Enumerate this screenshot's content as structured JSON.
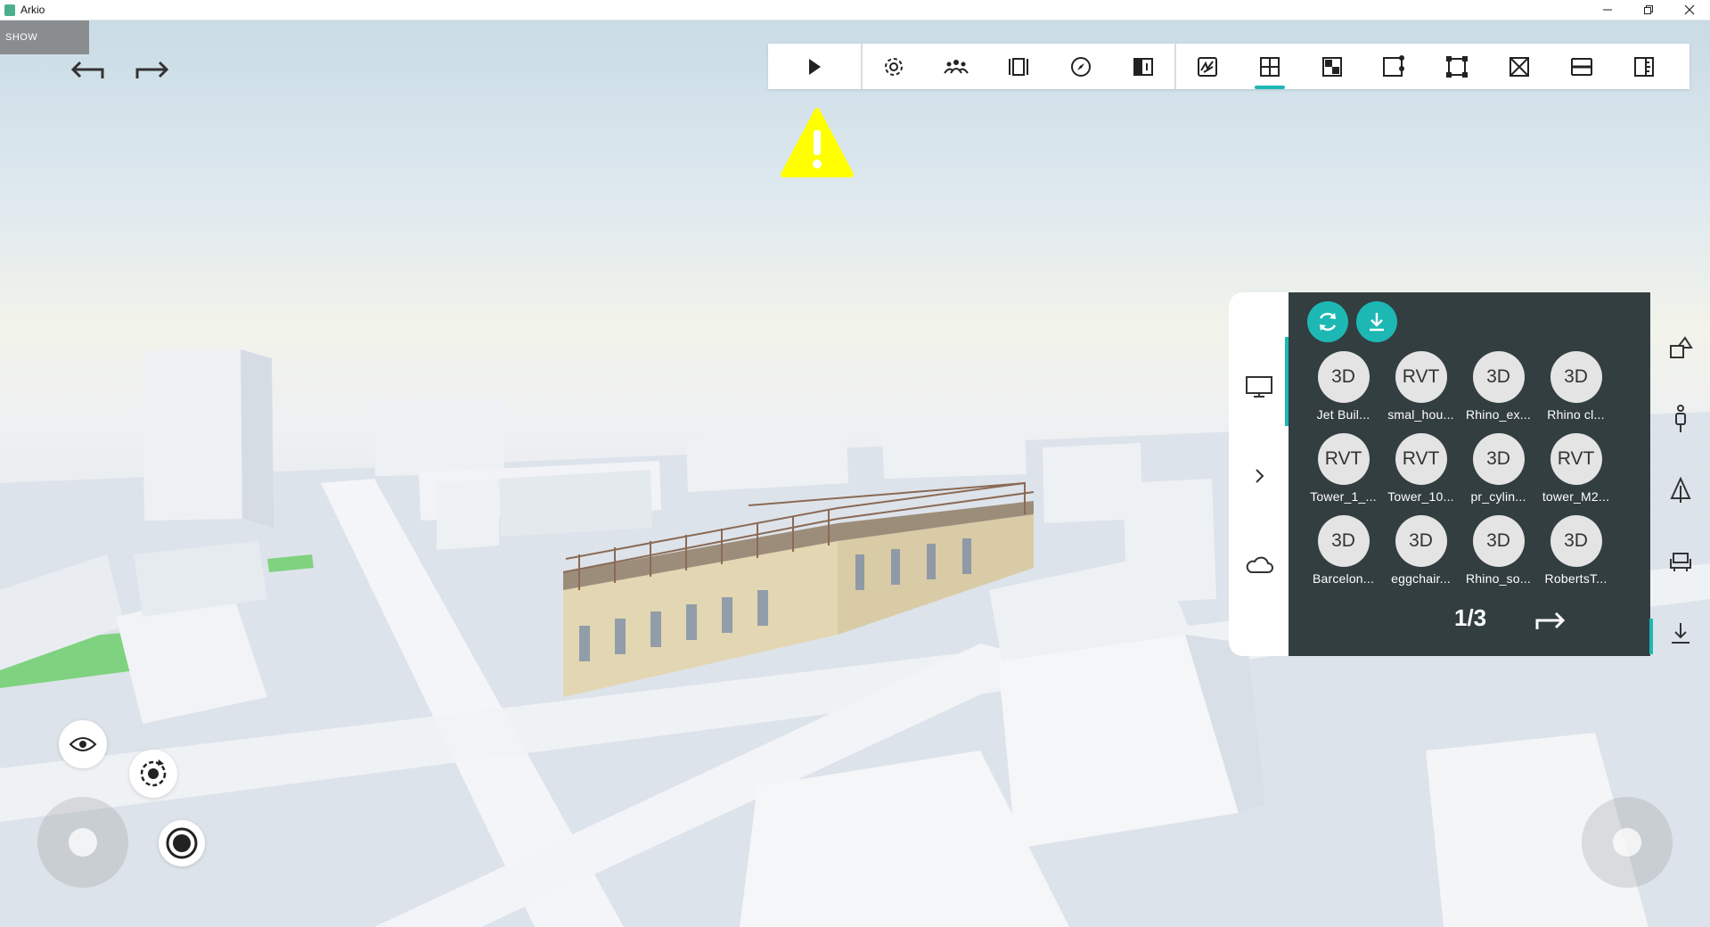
{
  "window": {
    "title": "Arkio",
    "controls": [
      "minimize-icon",
      "restore-icon",
      "close-icon"
    ]
  },
  "viewport": {
    "show_label": "SHOW",
    "undo_icon": "undo-icon",
    "redo_icon": "redo-icon"
  },
  "toolbar": {
    "play_icon": "play-icon",
    "group1": [
      {
        "name": "settings",
        "icon": "gear-icon"
      },
      {
        "name": "people",
        "icon": "people-icon"
      },
      {
        "name": "frame",
        "icon": "frame-icon"
      },
      {
        "name": "compass",
        "icon": "compass-icon"
      },
      {
        "name": "section",
        "icon": "section-icon"
      }
    ],
    "group2": [
      {
        "name": "draw",
        "icon": "draw-icon"
      },
      {
        "name": "plan",
        "icon": "plan-icon",
        "active": true
      },
      {
        "name": "material",
        "icon": "material-icon"
      },
      {
        "name": "select",
        "icon": "select-icon"
      },
      {
        "name": "bounds",
        "icon": "bounds-icon"
      },
      {
        "name": "cut",
        "icon": "cut-icon"
      },
      {
        "name": "levels",
        "icon": "levels-icon"
      },
      {
        "name": "measure",
        "icon": "measure-icon"
      }
    ],
    "accent": "#1db8b4"
  },
  "warning": {
    "icon": "warning-icon",
    "color": "#ffff00"
  },
  "side_panel": {
    "tabs": [
      "monitor-icon",
      "chevron-right-icon",
      "cloud-icon"
    ],
    "refresh_icon": "refresh-icon",
    "download_icon": "download-icon",
    "models": [
      {
        "badge": "3D",
        "label": "Jet Buil..."
      },
      {
        "badge": "RVT",
        "label": "smal_hou..."
      },
      {
        "badge": "3D",
        "label": "Rhino_ex..."
      },
      {
        "badge": "3D",
        "label": "Rhino cl..."
      },
      {
        "badge": "RVT",
        "label": "Tower_1_..."
      },
      {
        "badge": "RVT",
        "label": "Tower_10..."
      },
      {
        "badge": "3D",
        "label": "pr_cylin..."
      },
      {
        "badge": "RVT",
        "label": "tower_M2..."
      },
      {
        "badge": "3D",
        "label": "Barcelon..."
      },
      {
        "badge": "3D",
        "label": "eggchair..."
      },
      {
        "badge": "3D",
        "label": "Rhino_so..."
      },
      {
        "badge": "3D",
        "label": "RobertsT..."
      }
    ],
    "page": "1/3",
    "next_icon": "next-page-arrow-icon",
    "panel_color": "#333e41"
  },
  "right_bar": [
    "shapes-icon",
    "person-icon",
    "tree-icon",
    "chair-icon",
    "import-icon"
  ],
  "bottom_controls": {
    "eye_icon": "eye-icon",
    "orbit_icon": "orbit-icon",
    "record_icon": "record-icon"
  }
}
